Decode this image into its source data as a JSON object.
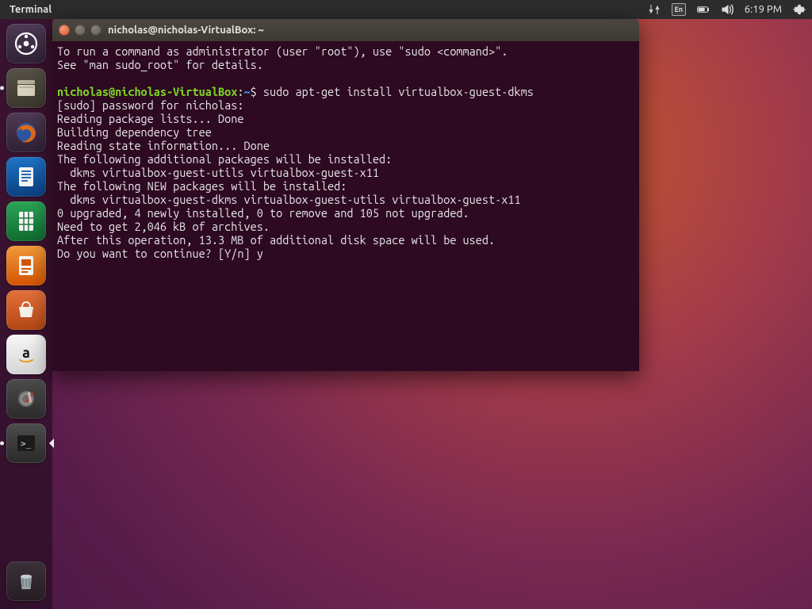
{
  "menubar": {
    "active_app": "Terminal",
    "lang_badge": "En",
    "clock": "6:19 PM"
  },
  "launcher": {
    "items": [
      {
        "name": "dash-icon"
      },
      {
        "name": "files-icon"
      },
      {
        "name": "firefox-icon"
      },
      {
        "name": "writer-icon"
      },
      {
        "name": "calc-icon"
      },
      {
        "name": "impress-icon"
      },
      {
        "name": "software-icon"
      },
      {
        "name": "amazon-icon"
      },
      {
        "name": "settings-icon"
      },
      {
        "name": "terminal-icon"
      }
    ],
    "trash": {
      "name": "trash-icon"
    }
  },
  "terminal": {
    "title": "nicholas@nicholas-VirtualBox: ~",
    "prompt_user": "nicholas@nicholas-VirtualBox",
    "prompt_sep": ":",
    "prompt_path": "~",
    "prompt_suffix": "$ ",
    "command": "sudo apt-get install virtualbox-guest-dkms",
    "lines": [
      "To run a command as administrator (user \"root\"), use \"sudo <command>\".",
      "See \"man sudo_root\" for details.",
      "",
      "__PROMPT__",
      "[sudo] password for nicholas:",
      "Reading package lists... Done",
      "Building dependency tree",
      "Reading state information... Done",
      "The following additional packages will be installed:",
      "  dkms virtualbox-guest-utils virtualbox-guest-x11",
      "The following NEW packages will be installed:",
      "  dkms virtualbox-guest-dkms virtualbox-guest-utils virtualbox-guest-x11",
      "0 upgraded, 4 newly installed, 0 to remove and 105 not upgraded.",
      "Need to get 2,046 kB of archives.",
      "After this operation, 13.3 MB of additional disk space will be used.",
      "Do you want to continue? [Y/n] y"
    ]
  }
}
